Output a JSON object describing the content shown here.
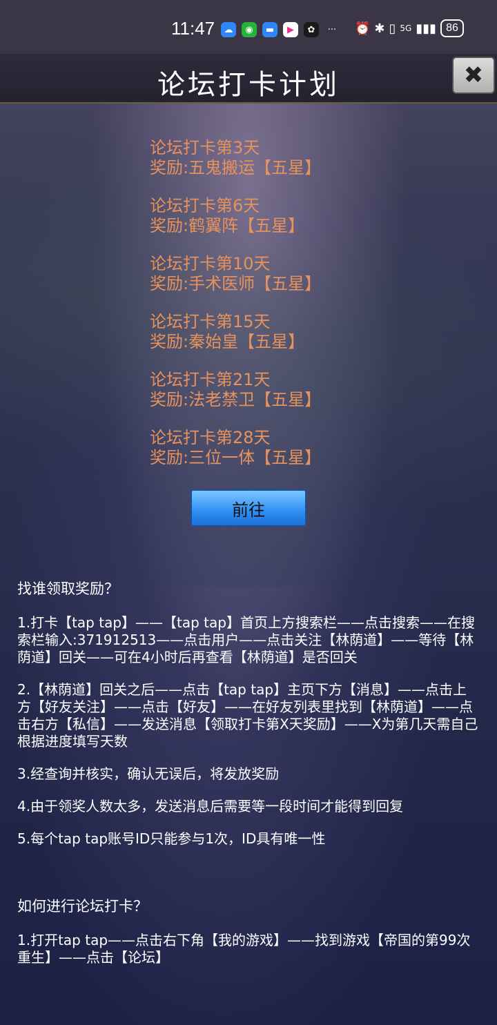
{
  "status_bar": {
    "time": "11:47",
    "more": "···",
    "network": "5G",
    "battery": "86"
  },
  "header": {
    "title": "论坛打卡计划",
    "close_symbol": "✖"
  },
  "rewards": [
    {
      "day": "论坛打卡第3天",
      "reward": "奖励:五鬼搬运【五星】"
    },
    {
      "day": "论坛打卡第6天",
      "reward": "奖励:鹤翼阵【五星】"
    },
    {
      "day": "论坛打卡第10天",
      "reward": "奖励:手术医师【五星】"
    },
    {
      "day": "论坛打卡第15天",
      "reward": "奖励:秦始皇【五星】"
    },
    {
      "day": "论坛打卡第21天",
      "reward": "奖励:法老禁卫【五星】"
    },
    {
      "day": "论坛打卡第28天",
      "reward": "奖励:三位一体【五星】"
    }
  ],
  "go_button": "前往",
  "claim_section": {
    "heading": "找谁领取奖励？",
    "steps": [
      "1.打卡【tap tap】——【tap tap】首页上方搜索栏——点击搜索——在搜索栏输入:371912513——点击用户——点击关注【林荫道】——等待【林荫道】回关——可在4小时后再查看【林荫道】是否回关",
      "2.【林荫道】回关之后——点击【tap tap】主页下方【消息】——点击上方【好友关注】——点击【好友】——在好友列表里找到【林荫道】——点击右方【私信】——发送消息【领取打卡第X天奖励】——X为第几天需自己根据进度填写天数",
      "3.经查询并核实，确认无误后，将发放奖励",
      "4.由于领奖人数太多，发送消息后需要等一段时间才能得到回复",
      "5.每个tap tap账号ID只能参与1次，ID具有唯一性"
    ]
  },
  "howto_section": {
    "heading": "如何进行论坛打卡？",
    "steps": [
      "1.打开tap tap——点击右下角【我的游戏】——找到游戏【帝国的第99次重生】——点击【论坛】"
    ]
  }
}
